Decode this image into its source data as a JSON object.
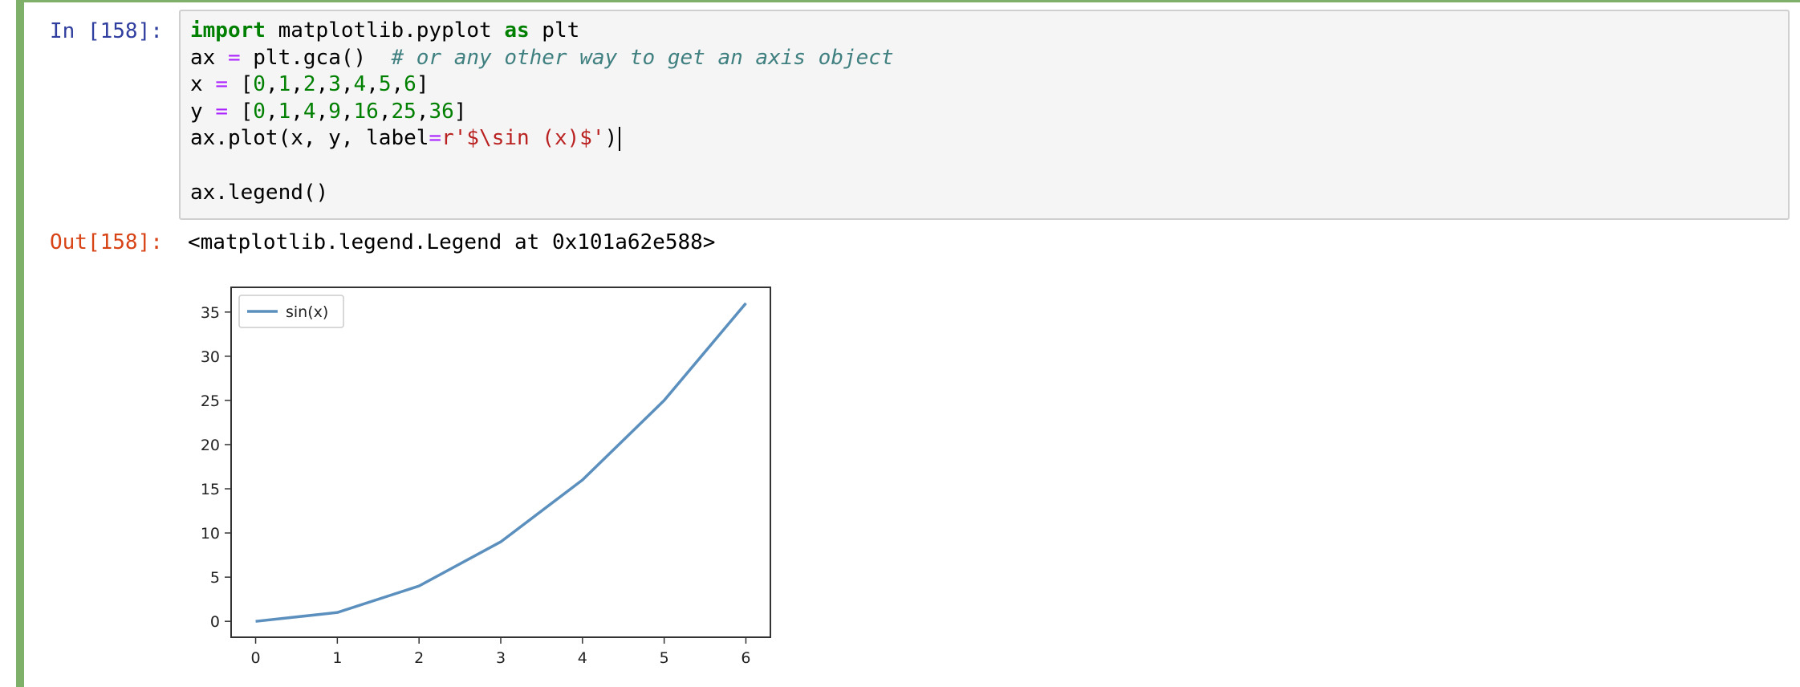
{
  "cell": {
    "in_prompt": "In [158]:",
    "out_prompt": "Out[158]:",
    "output_text": "<matplotlib.legend.Legend at 0x101a62e588>",
    "code_lines": [
      [
        {
          "t": "import",
          "c": "kw"
        },
        {
          "t": " matplotlib.pyplot ",
          "c": ""
        },
        {
          "t": "as",
          "c": "kw"
        },
        {
          "t": " plt",
          "c": ""
        }
      ],
      [
        {
          "t": "ax ",
          "c": ""
        },
        {
          "t": "=",
          "c": "op"
        },
        {
          "t": " plt.gca()  ",
          "c": ""
        },
        {
          "t": "# or any other way to get an axis object",
          "c": "cm"
        }
      ],
      [
        {
          "t": "x ",
          "c": ""
        },
        {
          "t": "=",
          "c": "op"
        },
        {
          "t": " [",
          "c": ""
        },
        {
          "t": "0",
          "c": "num"
        },
        {
          "t": ",",
          "c": ""
        },
        {
          "t": "1",
          "c": "num"
        },
        {
          "t": ",",
          "c": ""
        },
        {
          "t": "2",
          "c": "num"
        },
        {
          "t": ",",
          "c": ""
        },
        {
          "t": "3",
          "c": "num"
        },
        {
          "t": ",",
          "c": ""
        },
        {
          "t": "4",
          "c": "num"
        },
        {
          "t": ",",
          "c": ""
        },
        {
          "t": "5",
          "c": "num"
        },
        {
          "t": ",",
          "c": ""
        },
        {
          "t": "6",
          "c": "num"
        },
        {
          "t": "]",
          "c": ""
        }
      ],
      [
        {
          "t": "y ",
          "c": ""
        },
        {
          "t": "=",
          "c": "op"
        },
        {
          "t": " [",
          "c": ""
        },
        {
          "t": "0",
          "c": "num"
        },
        {
          "t": ",",
          "c": ""
        },
        {
          "t": "1",
          "c": "num"
        },
        {
          "t": ",",
          "c": ""
        },
        {
          "t": "4",
          "c": "num"
        },
        {
          "t": ",",
          "c": ""
        },
        {
          "t": "9",
          "c": "num"
        },
        {
          "t": ",",
          "c": ""
        },
        {
          "t": "16",
          "c": "num"
        },
        {
          "t": ",",
          "c": ""
        },
        {
          "t": "25",
          "c": "num"
        },
        {
          "t": ",",
          "c": ""
        },
        {
          "t": "36",
          "c": "num"
        },
        {
          "t": "]",
          "c": ""
        }
      ],
      [
        {
          "t": "ax.plot(x, y, label",
          "c": ""
        },
        {
          "t": "=",
          "c": "op"
        },
        {
          "t": "r'$\\sin (x)$'",
          "c": "str"
        },
        {
          "t": ")",
          "c": ""
        }
      ],
      [],
      [
        {
          "t": "ax.legend()",
          "c": ""
        }
      ]
    ]
  },
  "chart_data": {
    "type": "line",
    "x": [
      0,
      1,
      2,
      3,
      4,
      5,
      6
    ],
    "series": [
      {
        "name": "sin(x)",
        "values": [
          0,
          1,
          4,
          9,
          16,
          25,
          36
        ],
        "color": "#5b8fbd"
      }
    ],
    "xticks": [
      0,
      1,
      2,
      3,
      4,
      5,
      6
    ],
    "yticks": [
      0,
      5,
      10,
      15,
      20,
      25,
      30,
      35
    ],
    "xlim": [
      -0.3,
      6.3
    ],
    "ylim": [
      -1.8,
      37.8
    ],
    "legend": "top-left",
    "grid": false
  }
}
